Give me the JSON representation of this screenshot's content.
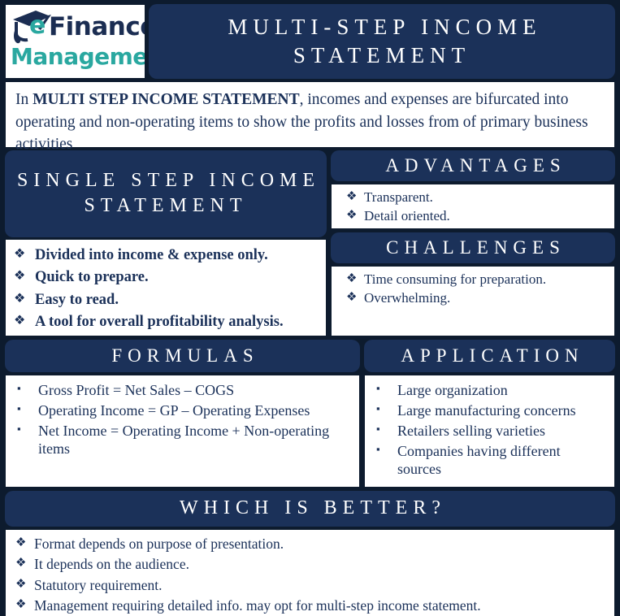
{
  "logo": {
    "icon": "graduation-cap-icon",
    "e": "e",
    "word1": "Finance",
    "word2": "Management"
  },
  "header": {
    "title": "MULTI-STEP INCOME STATEMENT"
  },
  "intro": {
    "lead": "In ",
    "bold": "MULTI STEP INCOME STATEMENT",
    "rest": ", incomes and expenses are bifurcated into operating and non-operating items to show the profits and losses from of primary business activities"
  },
  "single_step": {
    "title": "SINGLE STEP INCOME STATEMENT",
    "bullet_glyph": "❖",
    "items": [
      " Divided into income & expense only.",
      "Quick to prepare.",
      "Easy to read.",
      "A tool for overall profitability analysis."
    ]
  },
  "advantages": {
    "title": "ADVANTAGES",
    "bullet_glyph": "❖",
    "items": [
      "Transparent.",
      "Detail oriented."
    ]
  },
  "challenges": {
    "title": "CHALLENGES",
    "bullet_glyph": "❖",
    "items": [
      "Time consuming for preparation.",
      "Overwhelming."
    ]
  },
  "formulas": {
    "title": "FORMULAS",
    "bullet_glyph": "▪",
    "items": [
      "Gross Profit = Net Sales – COGS",
      "Operating Income = GP – Operating Expenses",
      "Net Income = Operating Income + Non-operating items"
    ]
  },
  "application": {
    "title": "APPLICATION",
    "bullet_glyph": "▪",
    "items": [
      "Large organization",
      "Large manufacturing concerns",
      "Retailers selling varieties",
      "Companies having different sources"
    ]
  },
  "which_is_better": {
    "title": "WHICH IS BETTER?",
    "bullet_glyph": "❖",
    "items": [
      "Format depends on purpose of presentation.",
      "It depends on the audience.",
      "Statutory requirement.",
      "Management requiring detailed info. may opt for multi-step income statement."
    ]
  },
  "colors": {
    "navy": "#1b3159",
    "frame": "#0d1b2e",
    "teal": "#2aa8a0",
    "white": "#ffffff"
  }
}
